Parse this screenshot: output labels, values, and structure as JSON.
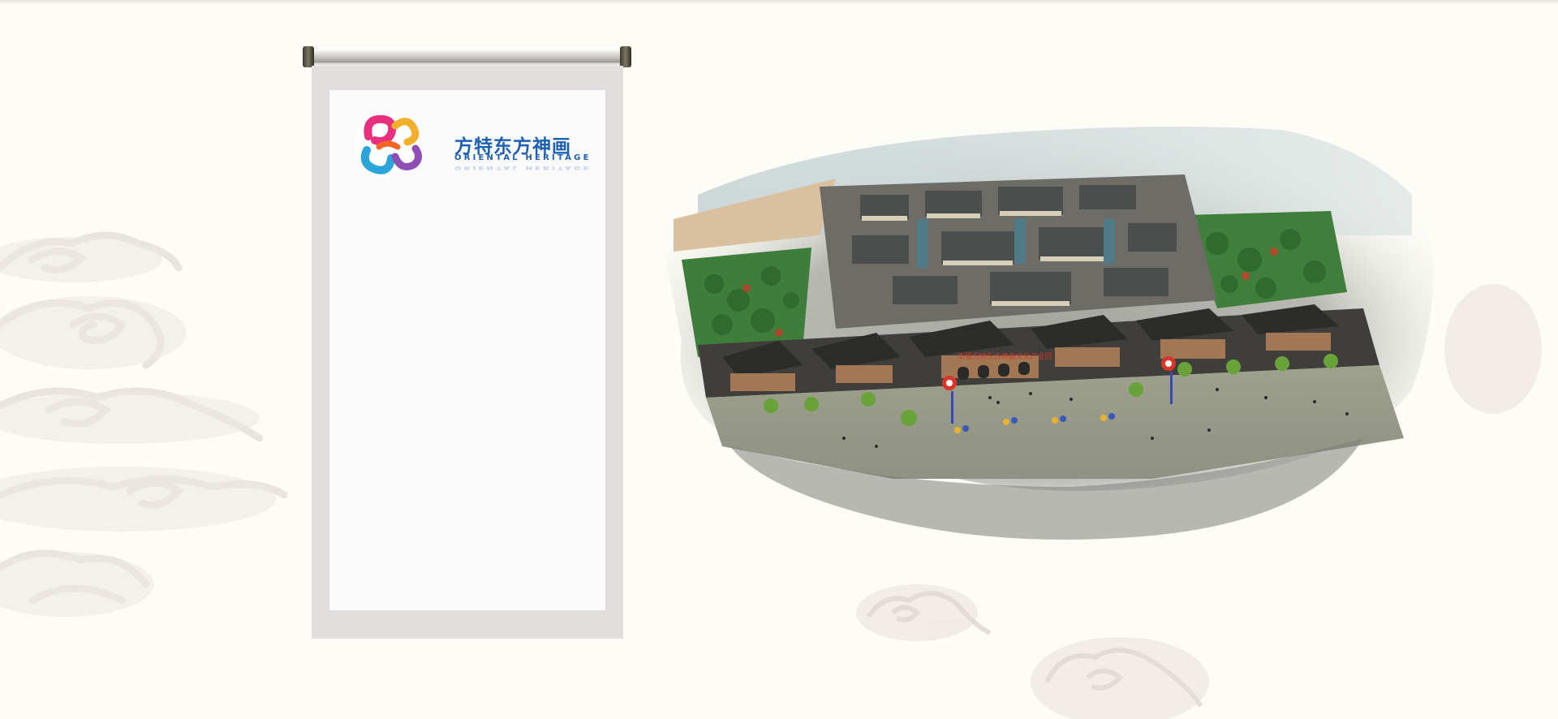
{
  "logo": {
    "title_cn": "方特东方神画",
    "title_en": "ORIENTAL HERITAGE"
  },
  "scene": {
    "banner_text": "华强方特东方神画文化产业园"
  },
  "colors": {
    "background": "#fdfcf7",
    "scroll_frame": "#e2dedd",
    "scroll_paper": "#fbfafa",
    "logo_blue": "#1d5fb0",
    "cloud": "#ece6e2"
  },
  "icons": [
    "cloud-decoration",
    "scroll-rod",
    "oriental-heritage-logo-mark"
  ]
}
